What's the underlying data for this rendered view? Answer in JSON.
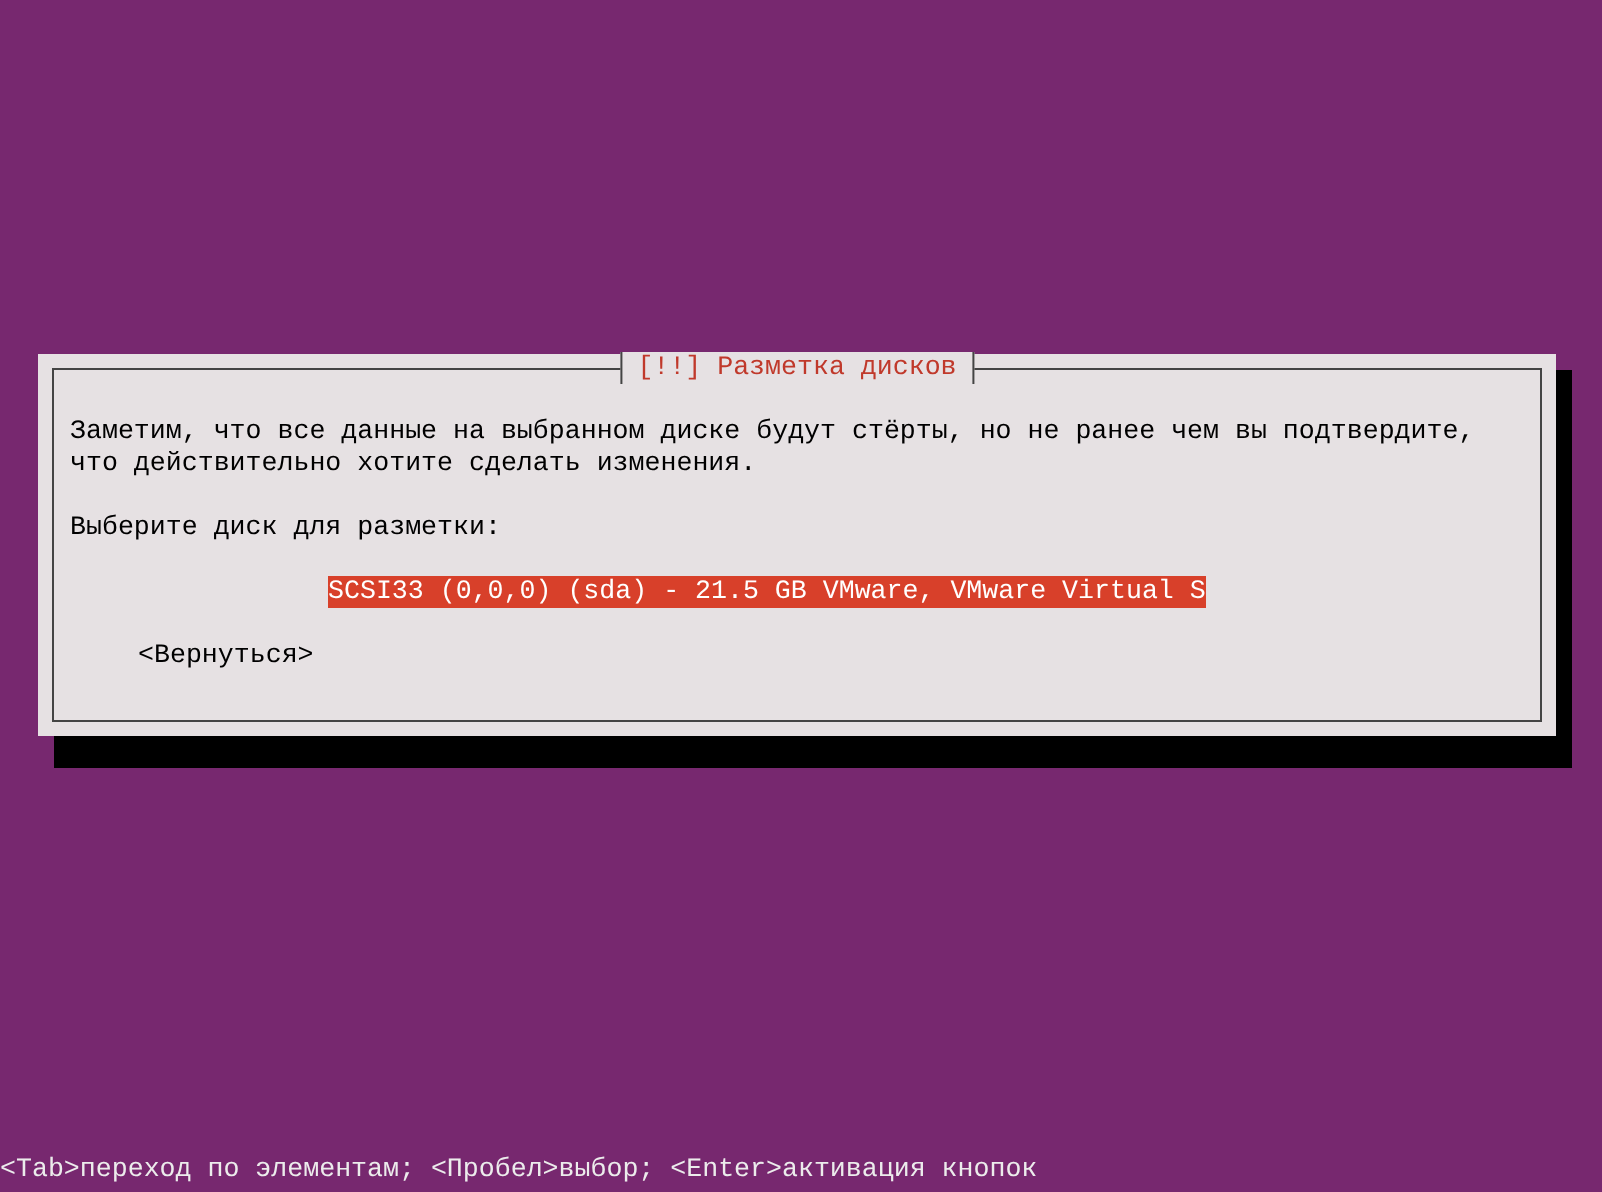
{
  "dialog": {
    "title": "[!!] Разметка дисков",
    "message": [
      "Заметим, что все данные на выбранном диске будут стёрты, но не ранее чем вы подтвердите,",
      "что действительно хотите сделать изменения."
    ],
    "prompt": "Выберите диск для разметки:",
    "disks": [
      {
        "label": "SCSI33 (0,0,0) (sda) - 21.5 GB VMware, VMware Virtual S",
        "selected": true
      }
    ],
    "back_button": "<Вернуться>"
  },
  "status_bar": "<Tab>переход по элементам; <Пробел>выбор; <Enter>активация кнопок"
}
